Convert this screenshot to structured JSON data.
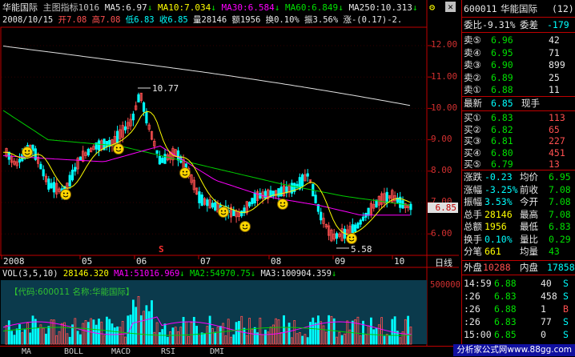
{
  "header": {
    "stock_name": "华能国际",
    "indicator_label": "主图指标1016",
    "ma5": "MA5:6.97",
    "ma10": "MA10:7.034",
    "ma30": "MA30:6.584",
    "ma60": "MA60:6.849",
    "ma250": "MA250:10.313",
    "date": "2008/10/15",
    "open": "开7.08",
    "high": "高7.08",
    "low": "低6.83",
    "close": "收6.85",
    "volume": "量28146",
    "amount": "额1956",
    "turnover": "换0.10%",
    "amplitude": "振3.56%",
    "change": "涨-(0.17)-2."
  },
  "price_axis": [
    "12.00",
    "11.00",
    "10.00",
    "9.00",
    "8.00",
    "7.00",
    "6.00"
  ],
  "current_price_tag": "6.85",
  "annotations": {
    "high_label": "10.77",
    "low_label": "5.58",
    "marker": "S"
  },
  "month_axis": [
    "2008",
    "05",
    "06",
    "07",
    "08",
    "09",
    "10"
  ],
  "period_label": "日线",
  "volume_header": {
    "vol": "VOL(3,5,10)",
    "val": "28146.320",
    "ma1": "MA1:51016.969",
    "ma2": "MA2:54970.75",
    "ma3": "MA3:100904.359"
  },
  "volume_axis": "500000",
  "info_box": "【代码:600011 名称:华能国际】",
  "tabs": [
    "MA",
    "BOLL",
    "MACD",
    "RSI",
    "DMI"
  ],
  "watermark": "分析家公式网www.88gg.com",
  "quote": {
    "code": "600011",
    "name": "华能国际",
    "page": "(12)",
    "weibi": "委比-9.31%",
    "weicha": "委差",
    "weicha_val": "-179",
    "asks": [
      {
        "label": "卖⑤",
        "price": "6.96",
        "vol": "42"
      },
      {
        "label": "卖④",
        "price": "6.95",
        "vol": "71"
      },
      {
        "label": "卖③",
        "price": "6.90",
        "vol": "899"
      },
      {
        "label": "卖②",
        "price": "6.89",
        "vol": "25"
      },
      {
        "label": "卖①",
        "price": "6.88",
        "vol": "11"
      }
    ],
    "last_label": "最新",
    "last_price": "6.85",
    "last_type": "现手",
    "bids": [
      {
        "label": "买①",
        "price": "6.83",
        "vol": "113"
      },
      {
        "label": "买②",
        "price": "6.82",
        "vol": "65"
      },
      {
        "label": "买③",
        "price": "6.81",
        "vol": "227"
      },
      {
        "label": "买④",
        "price": "6.80",
        "vol": "451"
      },
      {
        "label": "买⑤",
        "price": "6.79",
        "vol": "13"
      }
    ],
    "stats": [
      {
        "l1": "涨跌",
        "v1": "-0.23",
        "l2": "均价",
        "v2": "6.95"
      },
      {
        "l1": "涨幅",
        "v1": "-3.25%",
        "l2": "前收",
        "v2": "7.08"
      },
      {
        "l1": "振幅",
        "v1": "3.53%",
        "l2": "今开",
        "v2": "7.08"
      },
      {
        "l1": "总手",
        "v1": "28146",
        "l2": "最高",
        "v2": "7.08"
      },
      {
        "l1": "总额",
        "v1": "1956",
        "l2": "最低",
        "v2": "6.83"
      },
      {
        "l1": "换手",
        "v1": "0.10%",
        "l2": "量比",
        "v2": "0.29"
      },
      {
        "l1": "分笔",
        "v1": "661",
        "l2": "均量",
        "v2": "43"
      }
    ],
    "outer_label": "外盘",
    "outer_val": "10288",
    "inner_label": "内盘",
    "inner_val": "17858",
    "ticks": [
      {
        "time": "14:59",
        "price": "6.88",
        "vol": "40",
        "side": "S"
      },
      {
        "time": ":26",
        "price": "6.83",
        "vol": "458",
        "side": "S"
      },
      {
        "time": ":26",
        "price": "6.88",
        "vol": "1",
        "side": "B"
      },
      {
        "time": ":26",
        "price": "6.83",
        "vol": "77",
        "side": "S"
      },
      {
        "time": "15:00",
        "price": "6.85",
        "vol": "0",
        "side": "S"
      }
    ]
  },
  "colors": {
    "up": "#ff5050",
    "down": "#00ffff",
    "ma250": "#e0e0e0",
    "ma60": "#00cc00",
    "ma30": "#ff00ff",
    "ma10": "#ffff00",
    "ma5": "#ffffff",
    "frame": "#c00000"
  }
}
